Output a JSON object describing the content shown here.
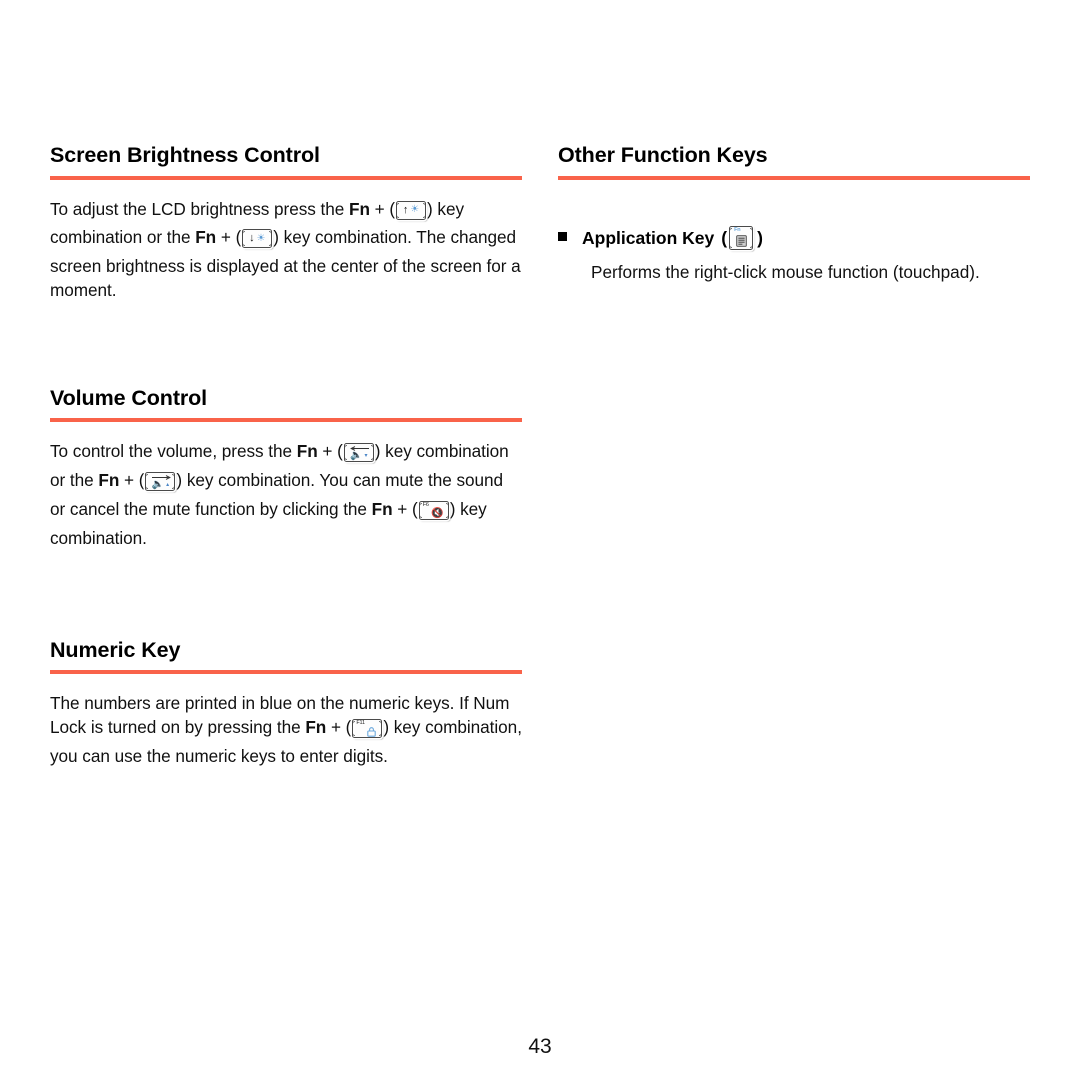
{
  "page": {
    "number": "43"
  },
  "theme": {
    "rule_color": "#f9634a",
    "text_color": "#111111",
    "key_accent_blue": "#5b9bd5"
  },
  "left_column": {
    "sections": [
      {
        "id": "screen-brightness-control",
        "title": "Screen Brightness Control",
        "paragraph": {
          "seg1": "To adjust the LCD brightness press the ",
          "fn1": "Fn",
          "plus1": " + (",
          "key1": {
            "name": "brightness-up-key",
            "arrow": "↑",
            "symbol": "☀",
            "fnum": ""
          },
          "seg2": ") key combination or the ",
          "fn2": "Fn",
          "plus2": " + (",
          "key2": {
            "name": "brightness-down-key",
            "arrow": "↓",
            "symbol": "☀",
            "fnum": ""
          },
          "seg3": ") key combination. The changed screen brightness is displayed at the center of the screen for a moment."
        }
      },
      {
        "id": "volume-control",
        "title": "Volume Control",
        "paragraph": {
          "seg1": "To control the volume, press the ",
          "fn1": "Fn",
          "plus1": " + (",
          "key1": {
            "name": "volume-down-key",
            "symbol": "🔈",
            "mark": "▾",
            "fnum": ""
          },
          "seg2": ") key combination or the ",
          "fn2": "Fn",
          "plus2": " + (",
          "key2": {
            "name": "volume-up-key",
            "symbol": "🔈",
            "mark": "▴",
            "fnum": ""
          },
          "seg3": ") key combination. You can mute the sound or cancel the mute function by clicking the ",
          "fn3": "Fn",
          "plus3": " + (",
          "key3": {
            "name": "mute-key",
            "symbol": "🔇",
            "fnum": "F6"
          },
          "seg4": ") key combination."
        }
      },
      {
        "id": "numeric-key",
        "title": "Numeric Key",
        "paragraph": {
          "seg1": "The numbers are printed in blue on the numeric keys. If Num Lock is turned on by pressing the ",
          "fn1": "Fn",
          "plus1": " + (",
          "key1": {
            "name": "num-lock-key",
            "symbol": "◯",
            "fnum": "F11"
          },
          "seg2": ") key combination, you can use the numeric keys to enter digits."
        }
      }
    ]
  },
  "right_column": {
    "sections": [
      {
        "id": "other-function-keys",
        "title": "Other Function Keys",
        "items": [
          {
            "bullet": "■",
            "label": "Application Key",
            "open_paren": "(",
            "key": {
              "name": "application-key",
              "fnum": "Fn",
              "symbol": "▤"
            },
            "close_paren": ")",
            "description": "Performs the right-click mouse function (touchpad)."
          }
        ]
      }
    ]
  }
}
